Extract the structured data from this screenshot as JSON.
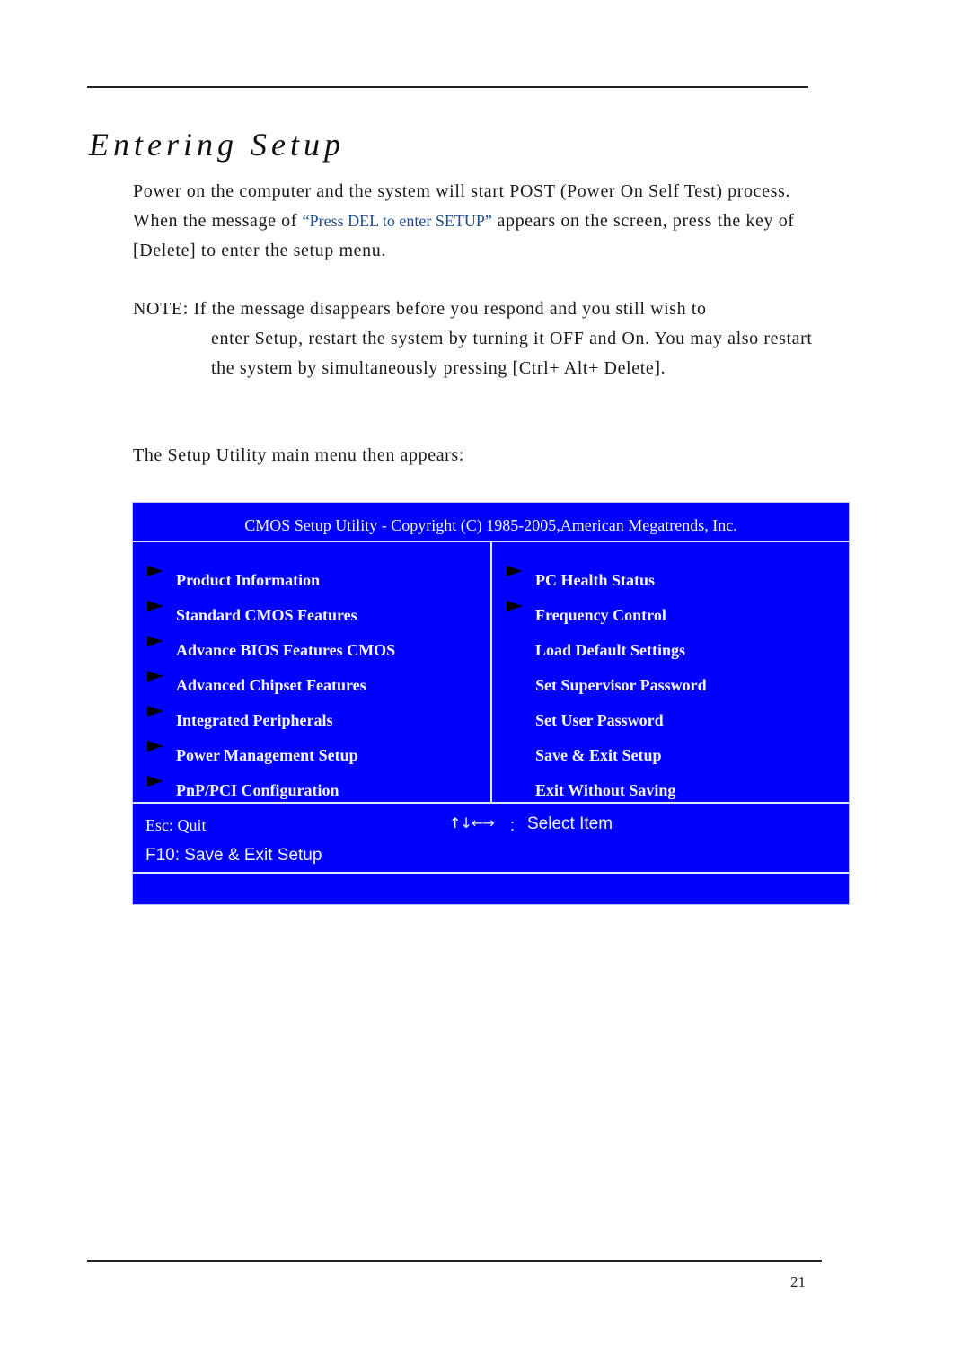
{
  "page": {
    "title": "Entering Setup",
    "intro": {
      "before": "Power on the computer and the system will start POST (Power On Self Test) process. When the message of ",
      "quote": "“Press DEL to enter SETUP”",
      "after": " appears on the screen, press the key of [Delete] to enter the setup menu."
    },
    "note": {
      "lead": "NOTE: If the message disappears before you respond and you still wish to",
      "body": "enter Setup, restart the system by turning it OFF and On. You may also restart the system by simultaneously pressing [Ctrl+ Alt+ Delete]."
    },
    "menu_intro": "The Setup Utility main menu then appears:",
    "page_number": "21"
  },
  "bios": {
    "header": "CMOS Setup Utility - Copyright (C) 1985-2005,American Megatrends, Inc.",
    "colors": {
      "background": "#0000fe",
      "text": "#f2f2ff",
      "arrow": "#000000"
    },
    "left_menu": [
      {
        "label": "Product Information",
        "submenu": true
      },
      {
        "label": "Standard CMOS Features",
        "submenu": true
      },
      {
        "label": "Advance BIOS Features CMOS",
        "submenu": true
      },
      {
        "label": "Advanced Chipset Features",
        "submenu": true
      },
      {
        "label": "Integrated Peripherals",
        "submenu": true
      },
      {
        "label": "Power Management Setup",
        "submenu": true
      },
      {
        "label": "PnP/PCI Configuration",
        "submenu": true
      }
    ],
    "right_menu": [
      {
        "label": "PC Health Status",
        "submenu": true
      },
      {
        "label": "Frequency Control",
        "submenu": true
      },
      {
        "label": "Load Default Settings",
        "submenu": false
      },
      {
        "label": "Set Supervisor Password",
        "submenu": false
      },
      {
        "label": "Set User Password",
        "submenu": false
      },
      {
        "label": "Save & Exit Setup",
        "submenu": false
      },
      {
        "label": "Exit Without Saving",
        "submenu": false
      }
    ],
    "footer": {
      "esc": "Esc: Quit",
      "f10": "F10: Save & Exit Setup",
      "nav_arrows": "↑↓←→",
      "nav_colon": ":",
      "nav_action": "Select Item"
    }
  }
}
